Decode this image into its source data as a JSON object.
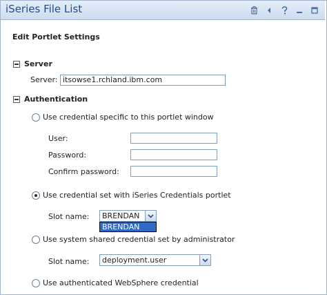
{
  "window": {
    "title": "iSeries File List"
  },
  "page": {
    "heading": "Edit Portlet Settings"
  },
  "server": {
    "section_label": "Server",
    "field_label": "Server:",
    "value": "itsowse1.rchland.ibm.com"
  },
  "authentication": {
    "section_label": "Authentication",
    "option_specific": {
      "label": "Use credential specific to this portlet window",
      "selected": false
    },
    "user_label": "User:",
    "password_label": "Password:",
    "confirm_label": "Confirm password:",
    "user_value": "",
    "password_value": "",
    "confirm_value": "",
    "option_iseries": {
      "label": "Use credential set with iSeries Credentials portlet",
      "selected": true
    },
    "slot_label": "Slot name:",
    "slot_value": "BRENDAN",
    "slot_options": [
      "BRENDAN"
    ],
    "option_shared": {
      "label": "Use system shared credential set by administrator",
      "selected": false
    },
    "shared_slot_label": "Slot name:",
    "shared_slot_value": "deployment.user",
    "option_websphere": {
      "label": "Use authenticated WebSphere credential",
      "selected": false
    }
  },
  "icons": [
    "trash-icon",
    "back-icon",
    "help-icon",
    "minimize-icon",
    "maximize-icon"
  ]
}
